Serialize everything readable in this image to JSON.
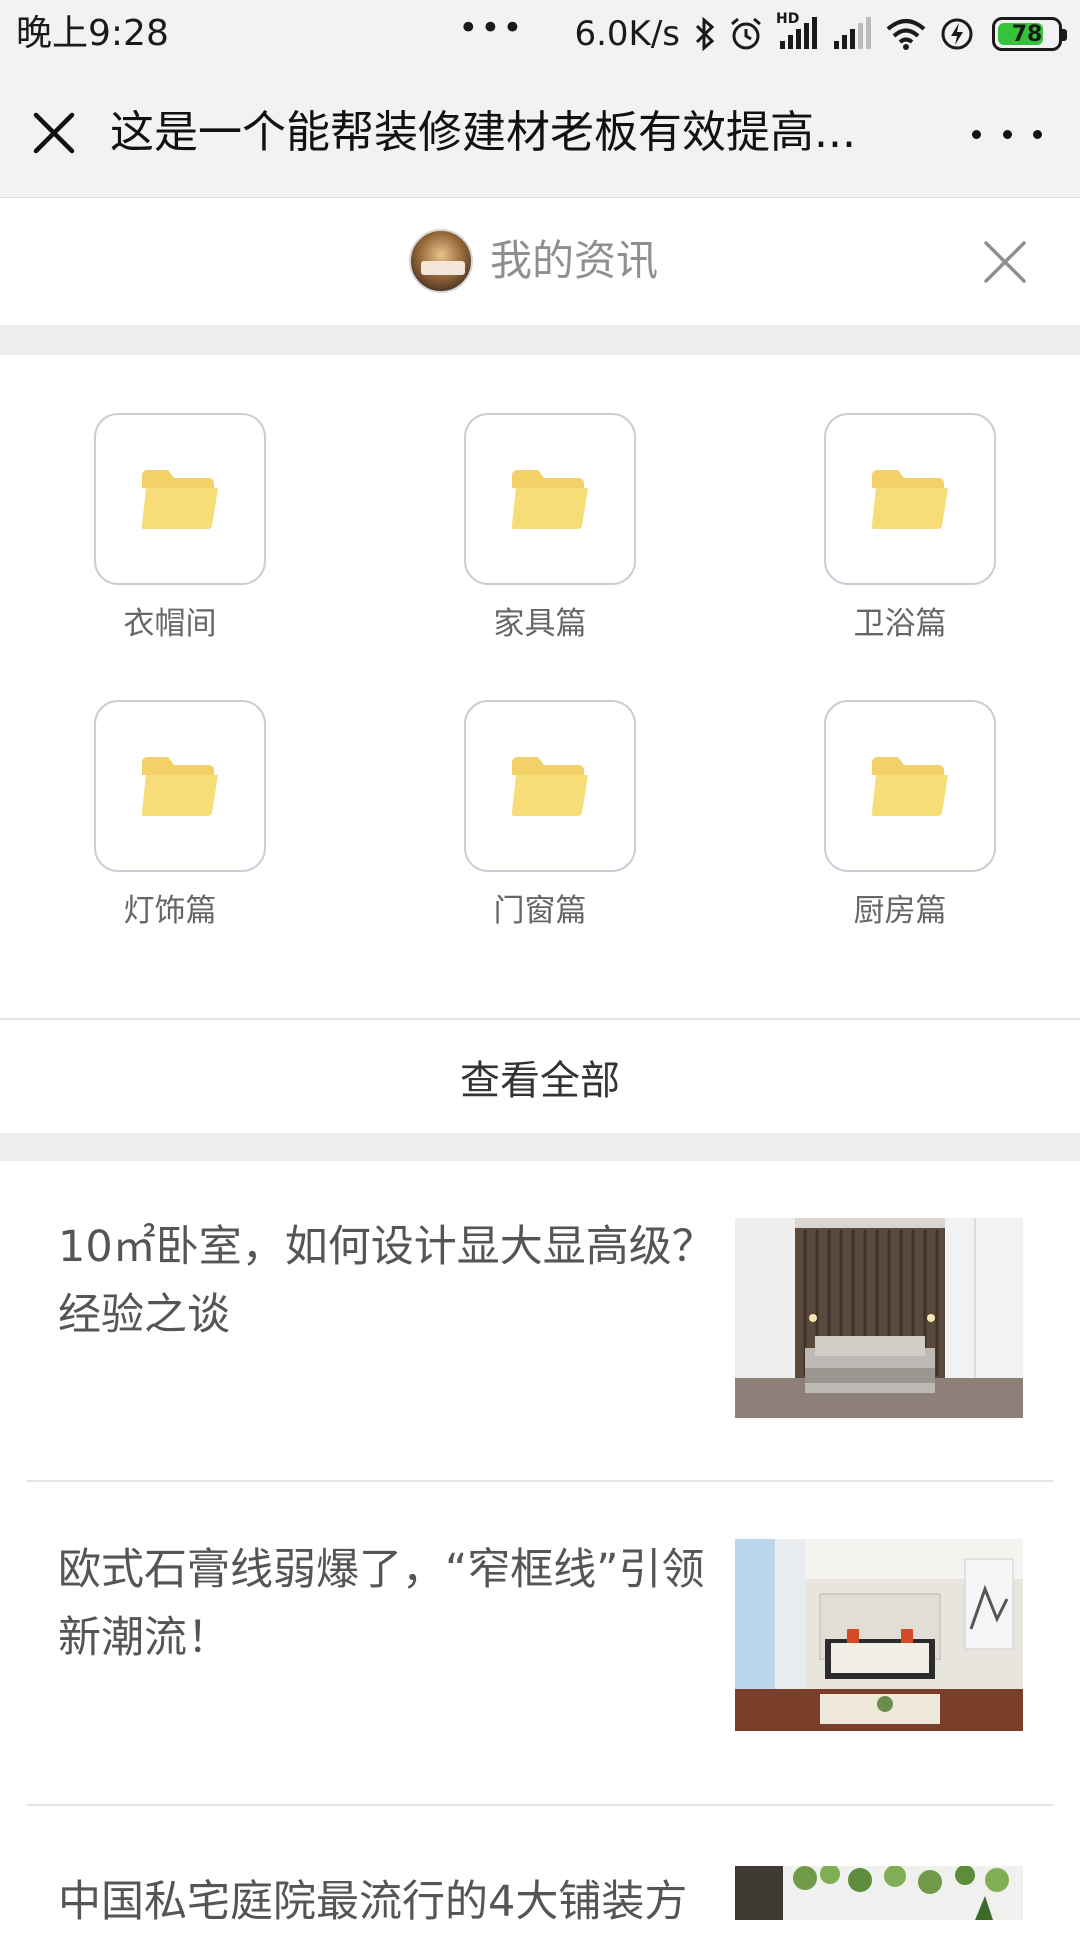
{
  "status_bar": {
    "time": "晚上9:28",
    "dots": "•••",
    "net_speed": "6.0K/s",
    "hd_label": "HD",
    "battery_level": 78,
    "battery_text": "78"
  },
  "title_bar": {
    "title": "这是一个能帮装修建材老板有效提高..."
  },
  "sub_header": {
    "title": "我的资讯"
  },
  "categories": [
    {
      "label": "衣帽间",
      "icon": "folder-icon"
    },
    {
      "label": "家具篇",
      "icon": "folder-icon"
    },
    {
      "label": "卫浴篇",
      "icon": "folder-icon"
    },
    {
      "label": "灯饰篇",
      "icon": "folder-icon"
    },
    {
      "label": "门窗篇",
      "icon": "folder-icon"
    },
    {
      "label": "厨房篇",
      "icon": "folder-icon"
    }
  ],
  "view_all_label": "查看全部",
  "articles": [
    {
      "title": "10㎡卧室，如何设计显大显高级？经验之谈"
    },
    {
      "title": "欧式石膏线弱爆了，“窄框线”引领新潮流！"
    },
    {
      "title": "中国私宅庭院最流行的4大铺装方"
    }
  ],
  "colors": {
    "folder": "#f8dc78",
    "folder_tab": "#f3d166",
    "tile_border": "#c9ced6",
    "battery_fill": "#37c23c"
  }
}
